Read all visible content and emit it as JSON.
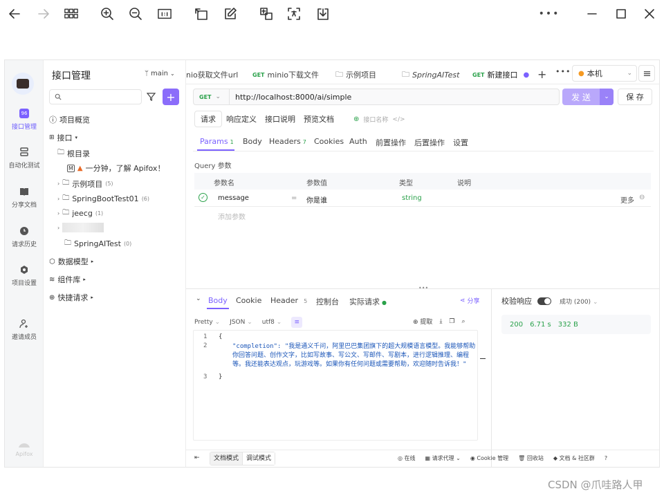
{
  "viewer": {
    "icons": [
      "arrow-left-icon",
      "arrow-right-icon",
      "grid-icon",
      "zoom-in-icon",
      "zoom-out-icon",
      "fit-icon",
      "rotate-icon",
      "edit-icon",
      "crop-icon",
      "translate-icon",
      "save-icon",
      "more-icon",
      "minimize-icon",
      "maximize-icon",
      "close-icon"
    ]
  },
  "rail": {
    "items": [
      {
        "label": "接口管理",
        "active": true
      },
      {
        "label": "自动化测试"
      },
      {
        "label": "分享文档"
      },
      {
        "label": "请求历史"
      },
      {
        "label": "项目设置"
      },
      {
        "label": "邀请成员"
      }
    ],
    "brand": "Apifox"
  },
  "tree": {
    "title": "接口管理",
    "branch": "main",
    "items": {
      "overview": "项目概览",
      "api": "接口",
      "root": "根目录",
      "intro": "一分钟，了解 Apifox！",
      "example": "示例项目",
      "example_count": "(5)",
      "sbt": "SpringBootTest01",
      "sbt_count": "(6)",
      "jeecg": "jeecg",
      "jeecg_count": "(1)",
      "springai": "SpringAITest",
      "springai_count": "(0)",
      "models": "数据模型",
      "components": "组件库",
      "quick": "快捷请求"
    }
  },
  "tabs": [
    {
      "label": "nio获取文件url",
      "method": ""
    },
    {
      "label": "minio下载文件",
      "method": "GET"
    },
    {
      "label": "示例项目",
      "method": ""
    },
    {
      "label": "SpringAITest",
      "method": ""
    },
    {
      "label": "新建接口",
      "method": "GET"
    }
  ],
  "env": "本机",
  "request": {
    "method": "GET",
    "url": "http://localhost:8000/ai/simple",
    "send": "发 送",
    "save": "保 存",
    "mode_tabs": [
      "请求",
      "响应定义",
      "接口说明",
      "预览文档"
    ],
    "api_name_placeholder": "接口名称",
    "param_tabs": {
      "params": "Params",
      "params_count": "1",
      "body": "Body",
      "headers": "Headers",
      "headers_count": "7",
      "cookies": "Cookies",
      "auth": "Auth",
      "pre": "前置操作",
      "post": "后置操作",
      "settings": "设置"
    },
    "query_label": "Query 参数",
    "columns": [
      "参数名",
      "参数值",
      "类型",
      "说明"
    ],
    "row": {
      "name": "message",
      "eq": "=",
      "value": "你是谁",
      "type": "string",
      "more": "更多"
    },
    "add_param": "添加参数"
  },
  "response": {
    "tabs": {
      "body": "Body",
      "cookie": "Cookie",
      "header": "Header",
      "header_count": "5",
      "console": "控制台",
      "actual": "实际请求"
    },
    "share": "分享",
    "format": "Pretty",
    "lang": "JSON",
    "enc": "utf8",
    "extract": "提取",
    "code_lines": [
      {
        "n": "1",
        "text": "{"
      },
      {
        "n": "2",
        "text": "\"completion\": \"我是通义千问，阿里巴巴集团旗下的超大规模语言模型。我能够帮助你回答问题、创作文字，比如写故事、写公文、写邮件、写剧本，进行逻辑推理、编程等。我还能表达观点，玩游戏等。如果你有任何问题或需要帮助，欢迎随时告诉我！\""
      },
      {
        "n": "3",
        "text": "}"
      }
    ],
    "validate": "校验响应",
    "status": "成功 (200)",
    "code": "200",
    "time": "6.71 s",
    "size": "332 B"
  },
  "footer": {
    "doc_mode": "文档模式",
    "debug_mode": "调试模式",
    "online": "在线",
    "proxy": "请求代理",
    "cookie": "Cookie 管理",
    "recycle": "回收站",
    "community": "文档 & 社区群"
  },
  "watermark": "CSDN @爪哇路人甲"
}
